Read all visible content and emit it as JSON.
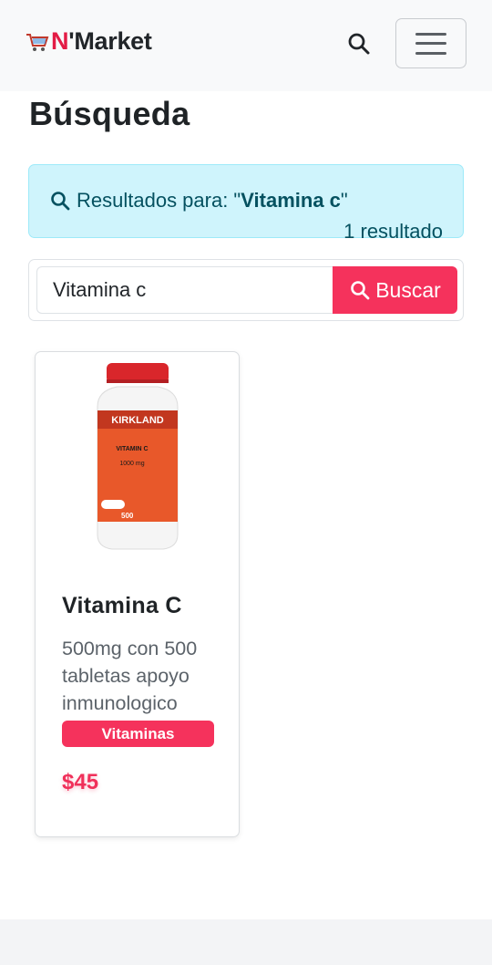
{
  "navbar": {
    "brand_n": "N",
    "brand_rest": "'Market"
  },
  "page": {
    "title": "Búsqueda"
  },
  "alert": {
    "prefix": "Resultados para: \"",
    "query": "Vitamina c",
    "suffix": "\"",
    "count": "1 resultado"
  },
  "search": {
    "value": "Vitamina c",
    "button_label": "Buscar"
  },
  "products": [
    {
      "name": "Vitamina C",
      "description": "500mg con 500 tabletas apoyo inmunologico",
      "category": "Vitaminas",
      "price": "$45",
      "image_label": {
        "brand": "KIRKLAND",
        "product": "VITAMIN C",
        "dose": "1000 mg",
        "count": "500"
      }
    }
  ],
  "colors": {
    "accent": "#f5325c",
    "brand_n": "#e31b45",
    "alert_bg": "#cff4fc",
    "alert_text": "#055160"
  }
}
